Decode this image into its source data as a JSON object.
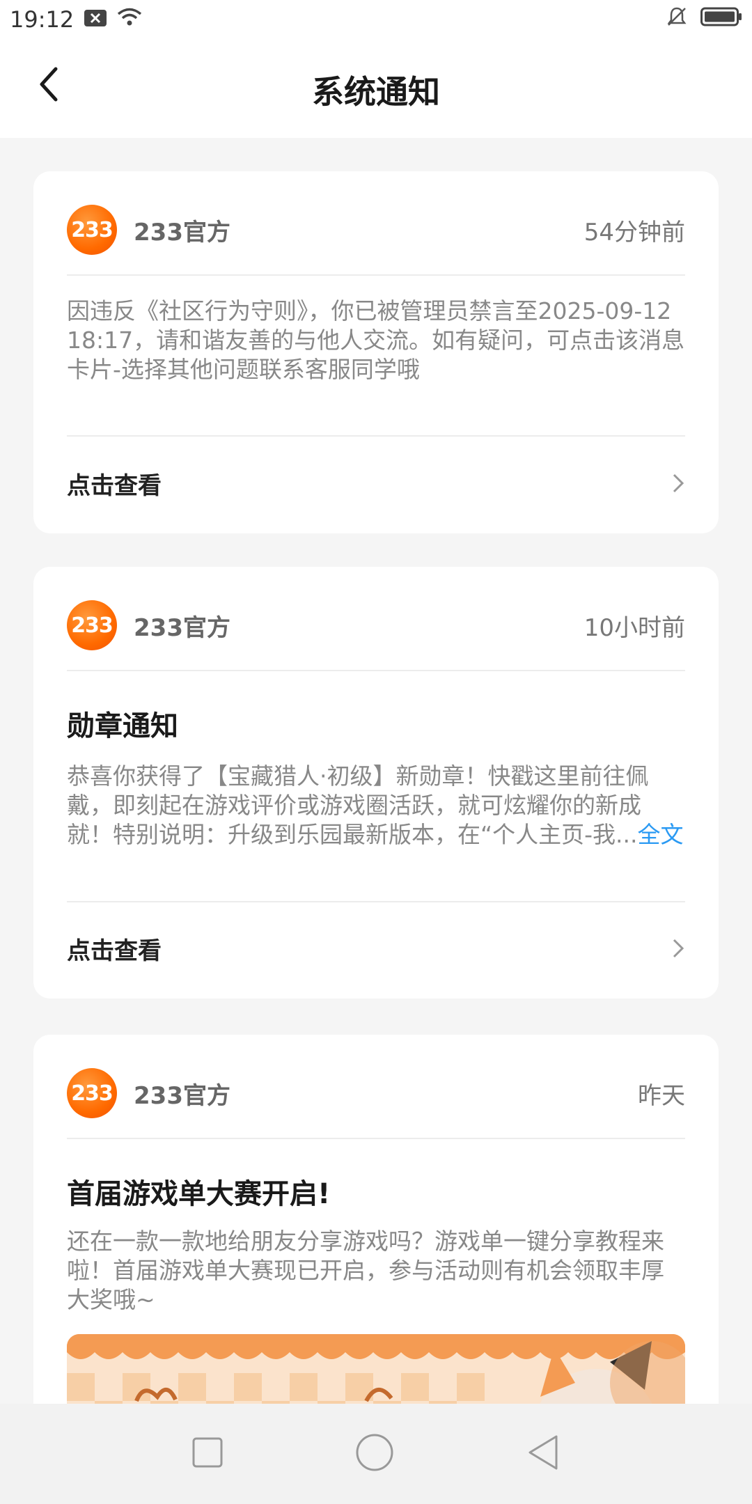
{
  "status_bar": {
    "time": "19:12"
  },
  "header": {
    "title": "系统通知"
  },
  "notifications": [
    {
      "sender": "233官方",
      "logo_text": "233",
      "time": "54分钟前",
      "body": "因违反《社区行为守则》，你已被管理员禁言至2025-09-12 18:17，请和谐友善的与他人交流。如有疑问，可点击该消息卡片-选择其他问题联系客服同学哦",
      "action": "点击查看"
    },
    {
      "sender": "233官方",
      "logo_text": "233",
      "time": "10小时前",
      "title": "勋章通知",
      "body": "恭喜你获得了【宝藏猎人·初级】新勋章！快戳这里前往佩戴，即刻起在游戏评价或游戏圈活跃，就可炫耀你的新成就！特别说明：升级到乐园最新版本，在“个人主页-我...",
      "more": "全文",
      "action": "点击查看"
    },
    {
      "sender": "233官方",
      "logo_text": "233",
      "time": "昨天",
      "title": "首届游戏单大赛开启!",
      "body": "还在一款一款地给朋友分享游戏吗？游戏单一键分享教程来啦！首届游戏单大赛现已开启，参与活动则有机会领取丰厚大奖哦~"
    }
  ],
  "colors": {
    "accent": "#2b9af3",
    "brand": "#ff6a00"
  }
}
